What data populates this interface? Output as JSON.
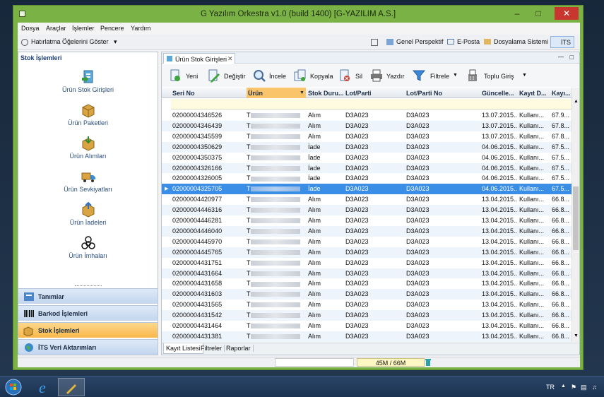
{
  "window": {
    "title": "G Yazılım Orkestra v1.0 (build 1400) [G-YAZILIM A.S.]"
  },
  "menu": [
    "Dosya",
    "Araçlar",
    "İşlemler",
    "Pencere",
    "Yardım"
  ],
  "toolbar": {
    "reminders": "Hatırlatma Öğelerini Göster",
    "general_perspective": "Genel Perspektif",
    "email": "E-Posta",
    "filing_system": "Dosyalama Sistemi",
    "its": "İTS"
  },
  "left_panel": {
    "title": "Stok İşlemleri",
    "items": [
      "Ürün Stok Girişleri",
      "Ürün Paketleri",
      "Ürün Alımları",
      "Ürün Sevkiyatları",
      "Ürün İadeleri",
      "Ürün İmhaları"
    ],
    "nav": [
      "Tanımlar",
      "Barkod İşlemleri",
      "Stok İşlemleri",
      "İTS Veri Aktarımları"
    ]
  },
  "document_tab": "Ürün Stok Girişleri",
  "actions": {
    "new": "Yeni",
    "edit": "Değiştir",
    "inspect": "İncele",
    "copy": "Kopyala",
    "delete": "Sil",
    "print": "Yazdır",
    "filter": "Filtrele",
    "bulk_entry": "Toplu Giriş"
  },
  "grid": {
    "columns": [
      "Seri No",
      "Ürün",
      "Stok Duru...",
      "Lot/Parti",
      "Lot/Parti No",
      "Güncelle...",
      "Kayıt D...",
      "Kayı..."
    ],
    "rows": [
      [
        "02000004346526",
        "T",
        "Alım",
        "D3A023",
        "D3A023",
        "13.07.2015...",
        "Kullanı...",
        "67.9..."
      ],
      [
        "02000004346439",
        "T",
        "Alım",
        "D3A023",
        "D3A023",
        "13.07.2015...",
        "Kullanı...",
        "67.8..."
      ],
      [
        "02000004345599",
        "T",
        "Alım",
        "D3A023",
        "D3A023",
        "13.07.2015...",
        "Kullanı...",
        "67.8..."
      ],
      [
        "02000004350629",
        "T",
        "İade",
        "D3A023",
        "D3A023",
        "04.06.2015...",
        "Kullanı...",
        "67.5..."
      ],
      [
        "02000004350375",
        "T",
        "İade",
        "D3A023",
        "D3A023",
        "04.06.2015...",
        "Kullanı...",
        "67.5..."
      ],
      [
        "02000004326166",
        "T",
        "İade",
        "D3A023",
        "D3A023",
        "04.06.2015...",
        "Kullanı...",
        "67.5..."
      ],
      [
        "02000004326005",
        "T",
        "İade",
        "D3A023",
        "D3A023",
        "04.06.2015...",
        "Kullanı...",
        "67.5..."
      ],
      [
        "02000004325705",
        "T",
        "İade",
        "D3A023",
        "D3A023",
        "04.06.2015...",
        "Kullanı...",
        "67.5..."
      ],
      [
        "02000004420977",
        "T",
        "Alım",
        "D3A023",
        "D3A023",
        "13.04.2015...",
        "Kullanı...",
        "66.8..."
      ],
      [
        "02000004446316",
        "T",
        "Alım",
        "D3A023",
        "D3A023",
        "13.04.2015...",
        "Kullanı...",
        "66.8..."
      ],
      [
        "02000004446281",
        "T",
        "Alım",
        "D3A023",
        "D3A023",
        "13.04.2015...",
        "Kullanı...",
        "66.8..."
      ],
      [
        "02000004446040",
        "T",
        "Alım",
        "D3A023",
        "D3A023",
        "13.04.2015...",
        "Kullanı...",
        "66.8..."
      ],
      [
        "02000004445970",
        "T",
        "Alım",
        "D3A023",
        "D3A023",
        "13.04.2015...",
        "Kullanı...",
        "66.8..."
      ],
      [
        "02000004445765",
        "T",
        "Alım",
        "D3A023",
        "D3A023",
        "13.04.2015...",
        "Kullanı...",
        "66.8..."
      ],
      [
        "02000004431751",
        "T",
        "Alım",
        "D3A023",
        "D3A023",
        "13.04.2015...",
        "Kullanı...",
        "66.8..."
      ],
      [
        "02000004431664",
        "T",
        "Alım",
        "D3A023",
        "D3A023",
        "13.04.2015...",
        "Kullanı...",
        "66.8..."
      ],
      [
        "02000004431658",
        "T",
        "Alım",
        "D3A023",
        "D3A023",
        "13.04.2015...",
        "Kullanı...",
        "66.8..."
      ],
      [
        "02000004431603",
        "T",
        "Alım",
        "D3A023",
        "D3A023",
        "13.04.2015...",
        "Kullanı...",
        "66.8..."
      ],
      [
        "02000004431565",
        "T",
        "Alım",
        "D3A023",
        "D3A023",
        "13.04.2015...",
        "Kullanı...",
        "66.8..."
      ],
      [
        "02000004431542",
        "T",
        "Alım",
        "D3A023",
        "D3A023",
        "13.04.2015...",
        "Kullanı...",
        "66.8..."
      ],
      [
        "02000004431464",
        "T",
        "Alım",
        "D3A023",
        "D3A023",
        "13.04.2015...",
        "Kullanı...",
        "66.8..."
      ],
      [
        "02000004431381",
        "T",
        "Alım",
        "D3A023",
        "D3A023",
        "13.04.2015...",
        "Kullanı...",
        "66.8..."
      ]
    ],
    "selected_row": 7
  },
  "bottom_tabs": [
    "Kayıt Listesi",
    "Filtreler",
    "Raporlar"
  ],
  "status": {
    "memory": "45M / 66M"
  },
  "taskbar": {
    "lang": "TR"
  }
}
